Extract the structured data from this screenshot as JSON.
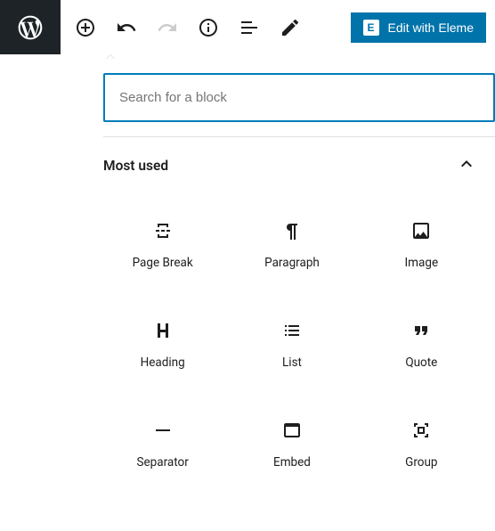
{
  "toolbar": {
    "edit_elementor_label": "Edit with Eleme"
  },
  "inserter": {
    "search_placeholder": "Search for a block",
    "section_title": "Most used",
    "blocks": [
      {
        "label": "Page Break",
        "icon": "page-break-icon"
      },
      {
        "label": "Paragraph",
        "icon": "paragraph-icon"
      },
      {
        "label": "Image",
        "icon": "image-icon"
      },
      {
        "label": "Heading",
        "icon": "heading-icon"
      },
      {
        "label": "List",
        "icon": "list-icon"
      },
      {
        "label": "Quote",
        "icon": "quote-icon"
      },
      {
        "label": "Separator",
        "icon": "separator-icon"
      },
      {
        "label": "Embed",
        "icon": "embed-icon"
      },
      {
        "label": "Group",
        "icon": "group-icon"
      }
    ]
  },
  "colors": {
    "accent": "#007cba",
    "elementor": "#0073aa"
  }
}
